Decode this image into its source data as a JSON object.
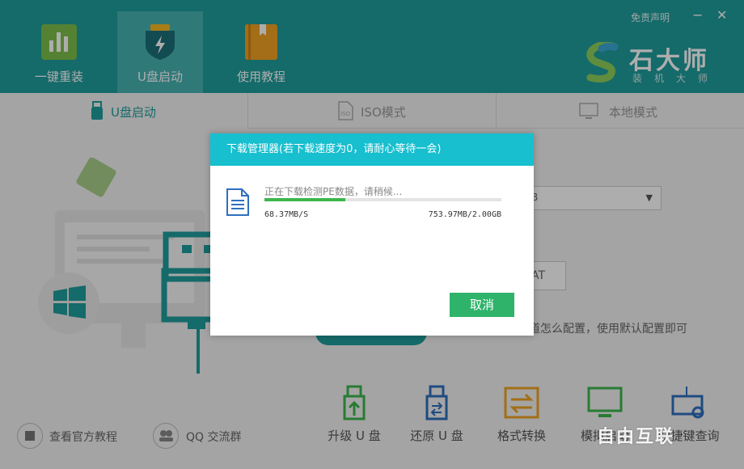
{
  "header": {
    "tabs": [
      {
        "label": "一键重装",
        "icon": "bar-chart-icon"
      },
      {
        "label": "U盘启动",
        "icon": "usb-shield-icon"
      },
      {
        "label": "使用教程",
        "icon": "book-icon"
      }
    ],
    "disclaimer": "免责声明",
    "minimize": "−",
    "close": "✕",
    "brand_name": "石大师",
    "brand_sub": "装机大师"
  },
  "subtabs": [
    {
      "label": "U盘启动",
      "icon": "usb-drive-icon"
    },
    {
      "label": "ISO模式",
      "icon": "iso-file-icon"
    },
    {
      "label": "本地模式",
      "icon": "monitor-icon"
    }
  ],
  "behind": {
    "select_value": "B",
    "format_value": "AT",
    "hint": "道怎么配置，使用默认配置即可"
  },
  "bottom_links": [
    {
      "label": "查看官方教程",
      "icon": "book-circle-icon"
    },
    {
      "label": "QQ 交流群",
      "icon": "group-circle-icon"
    }
  ],
  "tools": [
    {
      "label": "升级 U 盘",
      "icon": "usb-upgrade-icon"
    },
    {
      "label": "还原 U 盘",
      "icon": "usb-restore-icon"
    },
    {
      "label": "格式转换",
      "icon": "format-convert-icon"
    },
    {
      "label": "模拟启动",
      "icon": "simulate-boot-icon"
    },
    {
      "label": "快捷键查询",
      "icon": "keyboard-search-icon"
    }
  ],
  "modal": {
    "title": "下载管理器(若下载速度为0，请耐心等待一会)",
    "status": "正在下载检测PE数据，请稍候...",
    "progress": 0.34,
    "speed": "68.37MB/S",
    "size": "753.97MB/2.00GB",
    "cancel": "取消"
  },
  "colors": {
    "header": "#1f9c9c",
    "modal_header": "#17bfcf",
    "cancel": "#2fb36b",
    "progress": "#3cb64c"
  },
  "watermark": "自由互联"
}
